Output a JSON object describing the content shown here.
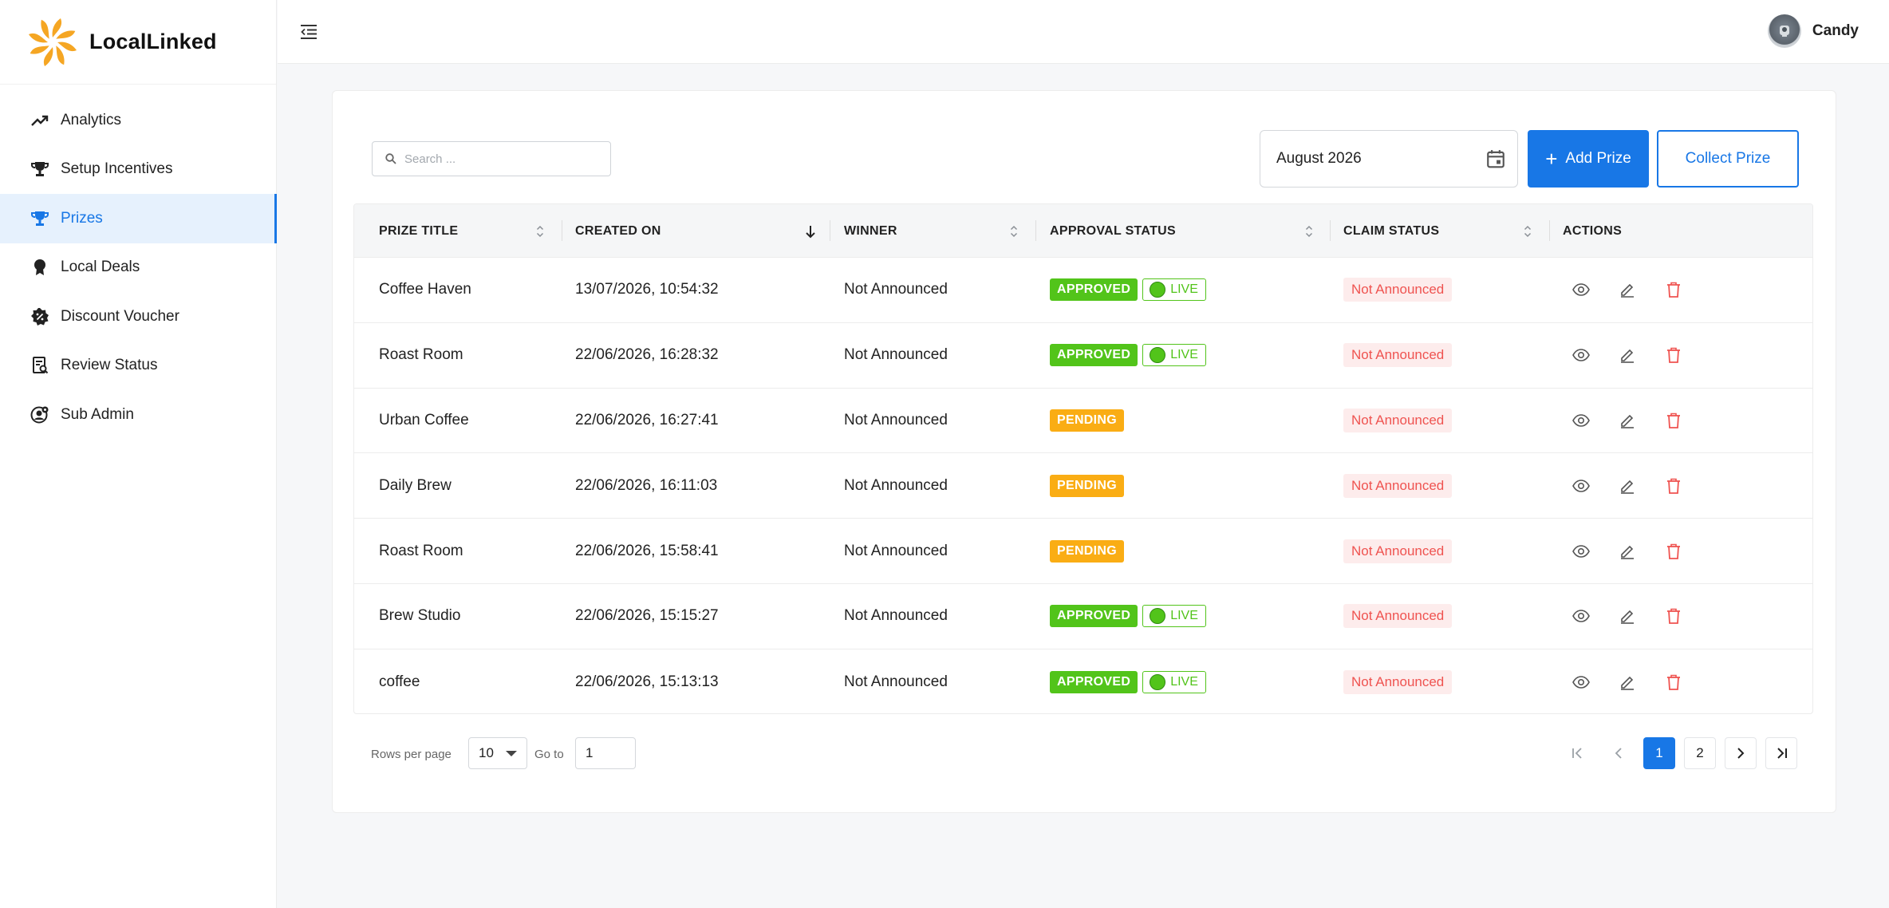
{
  "brand": {
    "name": "LocalLinked"
  },
  "sidebar": {
    "items": [
      {
        "label": "Analytics",
        "icon": "trending-up-icon",
        "active": false
      },
      {
        "label": "Setup Incentives",
        "icon": "trophy-icon",
        "active": false
      },
      {
        "label": "Prizes",
        "icon": "trophy-icon",
        "active": true
      },
      {
        "label": "Local Deals",
        "icon": "award-icon",
        "active": false
      },
      {
        "label": "Discount Voucher",
        "icon": "discount-badge-icon",
        "active": false
      },
      {
        "label": "Review Status",
        "icon": "review-icon",
        "active": false
      },
      {
        "label": "Sub Admin",
        "icon": "user-settings-icon",
        "active": false
      }
    ]
  },
  "header": {
    "user_name": "Candy"
  },
  "toolbar": {
    "search_placeholder": "Search ...",
    "date_value": "August 2026",
    "add_label": "Add Prize",
    "collect_label": "Collect Prize"
  },
  "table": {
    "columns": [
      "PRIZE TITLE",
      "CREATED ON",
      "WINNER",
      "APPROVAL STATUS",
      "CLAIM STATUS",
      "ACTIONS"
    ],
    "rows": [
      {
        "title": "Coffee Haven",
        "created": "13/07/2026, 10:54:32",
        "winner": "Not Announced",
        "approval": "APPROVED",
        "live": "LIVE",
        "claim": "Not Announced"
      },
      {
        "title": "Roast Room",
        "created": "22/06/2026, 16:28:32",
        "winner": "Not Announced",
        "approval": "APPROVED",
        "live": "LIVE",
        "claim": "Not Announced"
      },
      {
        "title": "Urban Coffee",
        "created": "22/06/2026, 16:27:41",
        "winner": "Not Announced",
        "approval": "PENDING",
        "live": "",
        "claim": "Not Announced"
      },
      {
        "title": "Daily Brew",
        "created": "22/06/2026, 16:11:03",
        "winner": "Not Announced",
        "approval": "PENDING",
        "live": "",
        "claim": "Not Announced"
      },
      {
        "title": "Roast Room",
        "created": "22/06/2026, 15:58:41",
        "winner": "Not Announced",
        "approval": "PENDING",
        "live": "",
        "claim": "Not Announced"
      },
      {
        "title": "Brew Studio",
        "created": "22/06/2026, 15:15:27",
        "winner": "Not Announced",
        "approval": "APPROVED",
        "live": "LIVE",
        "claim": "Not Announced"
      },
      {
        "title": "coffee",
        "created": "22/06/2026, 15:13:13",
        "winner": "Not Announced",
        "approval": "APPROVED",
        "live": "LIVE",
        "claim": "Not Announced"
      }
    ]
  },
  "pagination": {
    "rows_per_page_label": "Rows per page",
    "rows_per_page_value": "10",
    "goto_label": "Go to",
    "goto_value": "1",
    "pages": [
      "1",
      "2"
    ],
    "current_page": "1"
  },
  "colors": {
    "accent": "#1877e6",
    "approved": "#52c41a",
    "pending": "#faad14",
    "claim_text": "#ef5350",
    "claim_bg": "#fdecec",
    "logo": "#f5a623"
  }
}
